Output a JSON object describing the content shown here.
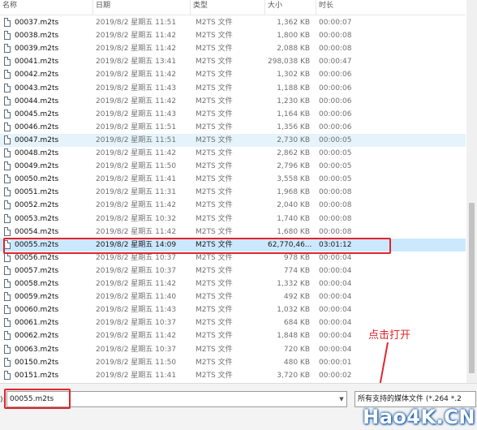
{
  "columns": {
    "name": "名称",
    "date": "日期",
    "type": "类型",
    "size": "大小",
    "duration": "时长"
  },
  "files": [
    {
      "name": "00037.m2ts",
      "date": "2019/8/2 星期五 11:51",
      "type": "M2TS 文件",
      "size": "1,362 KB",
      "duration": "00:00:07"
    },
    {
      "name": "00038.m2ts",
      "date": "2019/8/2 星期五 11:42",
      "type": "M2TS 文件",
      "size": "1,800 KB",
      "duration": "00:00:08"
    },
    {
      "name": "00039.m2ts",
      "date": "2019/8/2 星期五 11:42",
      "type": "M2TS 文件",
      "size": "2,088 KB",
      "duration": "00:00:08"
    },
    {
      "name": "00041.m2ts",
      "date": "2019/8/2 星期五 13:41",
      "type": "M2TS 文件",
      "size": "298,038 KB",
      "duration": "00:00:47"
    },
    {
      "name": "00042.m2ts",
      "date": "2019/8/2 星期五 11:42",
      "type": "M2TS 文件",
      "size": "1,302 KB",
      "duration": "00:00:06"
    },
    {
      "name": "00043.m2ts",
      "date": "2019/8/2 星期五 11:43",
      "type": "M2TS 文件",
      "size": "1,188 KB",
      "duration": "00:00:06"
    },
    {
      "name": "00044.m2ts",
      "date": "2019/8/2 星期五 11:42",
      "type": "M2TS 文件",
      "size": "1,230 KB",
      "duration": "00:00:06"
    },
    {
      "name": "00045.m2ts",
      "date": "2019/8/2 星期五 11:43",
      "type": "M2TS 文件",
      "size": "1,164 KB",
      "duration": "00:00:06"
    },
    {
      "name": "00046.m2ts",
      "date": "2019/8/2 星期五 11:51",
      "type": "M2TS 文件",
      "size": "1,356 KB",
      "duration": "00:00:06"
    },
    {
      "name": "00047.m2ts",
      "date": "2019/8/2 星期五 11:51",
      "type": "M2TS 文件",
      "size": "2,730 KB",
      "duration": "00:00:05"
    },
    {
      "name": "00048.m2ts",
      "date": "2019/8/2 星期五 11:42",
      "type": "M2TS 文件",
      "size": "2,862 KB",
      "duration": "00:00:05"
    },
    {
      "name": "00049.m2ts",
      "date": "2019/8/2 星期五 11:50",
      "type": "M2TS 文件",
      "size": "2,796 KB",
      "duration": "00:00:05"
    },
    {
      "name": "00050.m2ts",
      "date": "2019/8/2 星期五 11:41",
      "type": "M2TS 文件",
      "size": "3,558 KB",
      "duration": "00:00:05"
    },
    {
      "name": "00051.m2ts",
      "date": "2019/8/2 星期五 11:31",
      "type": "M2TS 文件",
      "size": "1,968 KB",
      "duration": "00:00:08"
    },
    {
      "name": "00052.m2ts",
      "date": "2019/8/2 星期五 11:42",
      "type": "M2TS 文件",
      "size": "2,040 KB",
      "duration": "00:00:08"
    },
    {
      "name": "00053.m2ts",
      "date": "2019/8/2 星期五 10:32",
      "type": "M2TS 文件",
      "size": "1,740 KB",
      "duration": "00:00:08"
    },
    {
      "name": "00054.m2ts",
      "date": "2019/8/2 星期五 11:42",
      "type": "M2TS 文件",
      "size": "1,680 KB",
      "duration": "00:00:08"
    },
    {
      "name": "00055.m2ts",
      "date": "2019/8/2 星期五 14:09",
      "type": "M2TS 文件",
      "size": "62,770,46...",
      "duration": "03:01:12"
    },
    {
      "name": "00056.m2ts",
      "date": "2019/8/2 星期五 10:37",
      "type": "M2TS 文件",
      "size": "978 KB",
      "duration": "00:00:04"
    },
    {
      "name": "00057.m2ts",
      "date": "2019/8/2 星期五 10:37",
      "type": "M2TS 文件",
      "size": "774 KB",
      "duration": "00:00:04"
    },
    {
      "name": "00058.m2ts",
      "date": "2019/8/2 星期五 11:42",
      "type": "M2TS 文件",
      "size": "1,332 KB",
      "duration": "00:00:04"
    },
    {
      "name": "00059.m2ts",
      "date": "2019/8/2 星期五 11:40",
      "type": "M2TS 文件",
      "size": "492 KB",
      "duration": "00:00:04"
    },
    {
      "name": "00060.m2ts",
      "date": "2019/8/2 星期五 11:43",
      "type": "M2TS 文件",
      "size": "1,032 KB",
      "duration": "00:00:04"
    },
    {
      "name": "00061.m2ts",
      "date": "2019/8/2 星期五 10:37",
      "type": "M2TS 文件",
      "size": "684 KB",
      "duration": "00:00:04"
    },
    {
      "name": "00062.m2ts",
      "date": "2019/8/2 星期五 11:42",
      "type": "M2TS 文件",
      "size": "1,848 KB",
      "duration": "00:00:04"
    },
    {
      "name": "00063.m2ts",
      "date": "2019/8/2 星期五 10:37",
      "type": "M2TS 文件",
      "size": "720 KB",
      "duration": "00:00:04"
    },
    {
      "name": "00150.m2ts",
      "date": "2019/8/2 星期五 11:50",
      "type": "M2TS 文件",
      "size": "480 KB",
      "duration": "00:00:01"
    },
    {
      "name": "00151.m2ts",
      "date": "2019/8/2 星期五 11:41",
      "type": "M2TS 文件",
      "size": "3,720 KB",
      "duration": "00:00:02"
    }
  ],
  "hover_index": 9,
  "selected_index": 17,
  "annotation_text": "点击打开",
  "filename_label": "):",
  "filename_value": "00055.m2ts",
  "filter_value": "所有支持的媒体文件 (*.264 *.2",
  "watermark": "Hao4K.CN",
  "colors": {
    "highlight": "#e0252c",
    "selected": "#cce8ff",
    "hover": "#e5f3fb"
  }
}
